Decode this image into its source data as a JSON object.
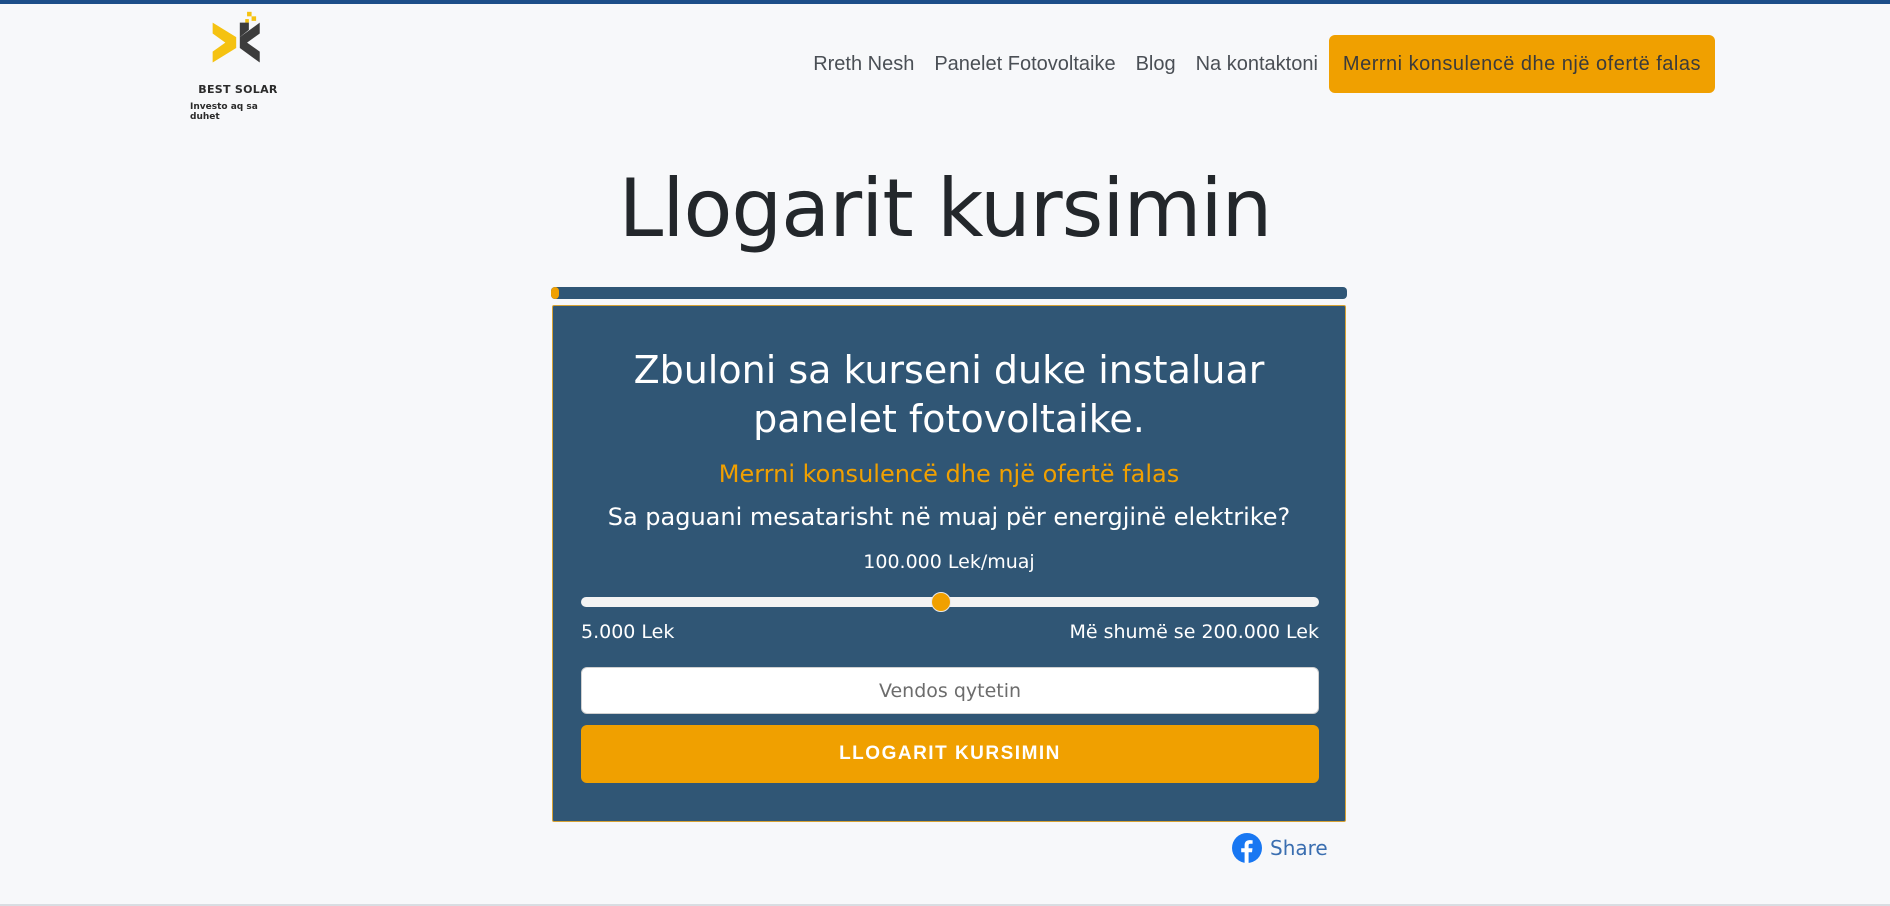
{
  "logo": {
    "brand": "BEST SOLAR",
    "tagline": "Investo aq sa duhet",
    "colors": {
      "yellow": "#f5c211",
      "dark": "#3c3c3c"
    }
  },
  "nav": {
    "items": [
      {
        "label": "Rreth Nesh"
      },
      {
        "label": "Panelet Fotovoltaike"
      },
      {
        "label": "Blog"
      },
      {
        "label": "Na kontaktoni"
      }
    ],
    "cta_label": "Merrni konsulencë dhe një ofertë falas"
  },
  "page_title": "Llogarit kursimin",
  "progress": {
    "value_percent": 1
  },
  "card": {
    "heading": "Zbuloni sa kurseni duke instaluar panelet fotovoltaike.",
    "offer": "Merrni konsulencë dhe një ofertë falas",
    "question": "Sa paguani mesatarisht në muaj për energjinë elektrike?",
    "amount_label": "100.000 Lek/muaj",
    "slider": {
      "min": 5000,
      "max": 200000,
      "value": 100000
    },
    "range_min_label": "5.000 Lek",
    "range_max_label": "Më shumë se 200.000 Lek",
    "city_placeholder": "Vendos qytetin",
    "button_label": "LLOGARIT KURSIMIN"
  },
  "share": {
    "label": "Share",
    "icon": "facebook-icon"
  },
  "colors": {
    "accent": "#f0a000",
    "card_bg": "#305675",
    "top_border": "#1d4e89",
    "facebook": "#1877f2"
  }
}
